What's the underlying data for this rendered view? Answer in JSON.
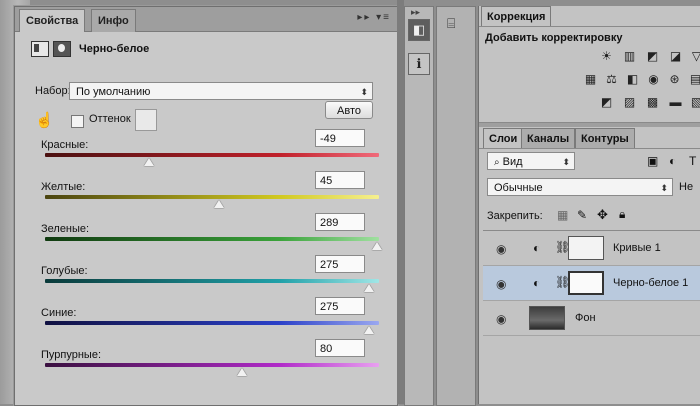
{
  "properties_panel": {
    "tabs": [
      {
        "label": "Свойства"
      },
      {
        "label": "Инфо"
      }
    ],
    "menu_icons": "▸▸ ▾≡",
    "title": "Черно-белое",
    "preset_label": "Набор:",
    "preset_value": "По умолчанию",
    "tint_label": "Оттенок",
    "auto_button": "Авто",
    "sliders": [
      {
        "label": "Красные:",
        "value": "-49",
        "gradient": [
          "#4a1010",
          "#c0202a",
          "#f06a7a"
        ],
        "position": 0.31
      },
      {
        "label": "Желтые:",
        "value": "45",
        "gradient": [
          "#4a4410",
          "#d0c820",
          "#f6f090"
        ],
        "position": 0.52
      },
      {
        "label": "Зеленые:",
        "value": "289",
        "gradient": [
          "#103a10",
          "#3aa23a",
          "#a0e0a0"
        ],
        "position": 0.995
      },
      {
        "label": "Голубые:",
        "value": "275",
        "gradient": [
          "#0a3a3a",
          "#20a0a8",
          "#a0e6e6"
        ],
        "position": 0.97
      },
      {
        "label": "Синие:",
        "value": "275",
        "gradient": [
          "#101040",
          "#2a40c8",
          "#9aa8f0"
        ],
        "position": 0.97
      },
      {
        "label": "Пурпурные:",
        "value": "80",
        "gradient": [
          "#3a1040",
          "#b02ac8",
          "#e8a0f0"
        ],
        "position": 0.59
      }
    ]
  },
  "right_panel": {
    "correction_tab": "Коррекция",
    "add_correction": "Добавить корректировку",
    "layer_tabs": [
      {
        "label": "Слои"
      },
      {
        "label": "Каналы"
      },
      {
        "label": "Контуры"
      }
    ],
    "filter_kind": "Вид",
    "blend_mode": "Обычные",
    "opacity_cut": "Не",
    "lock_label": "Закрепить:",
    "layers": [
      {
        "name": "Кривые 1",
        "selected": false
      },
      {
        "name": "Черно-белое 1",
        "selected": true
      },
      {
        "name": "Фон",
        "selected": false
      }
    ]
  },
  "colors": {
    "panel_bg": "#c9c9c9",
    "selected_row": "#b9c9dd",
    "accent": "#2a60b0"
  }
}
